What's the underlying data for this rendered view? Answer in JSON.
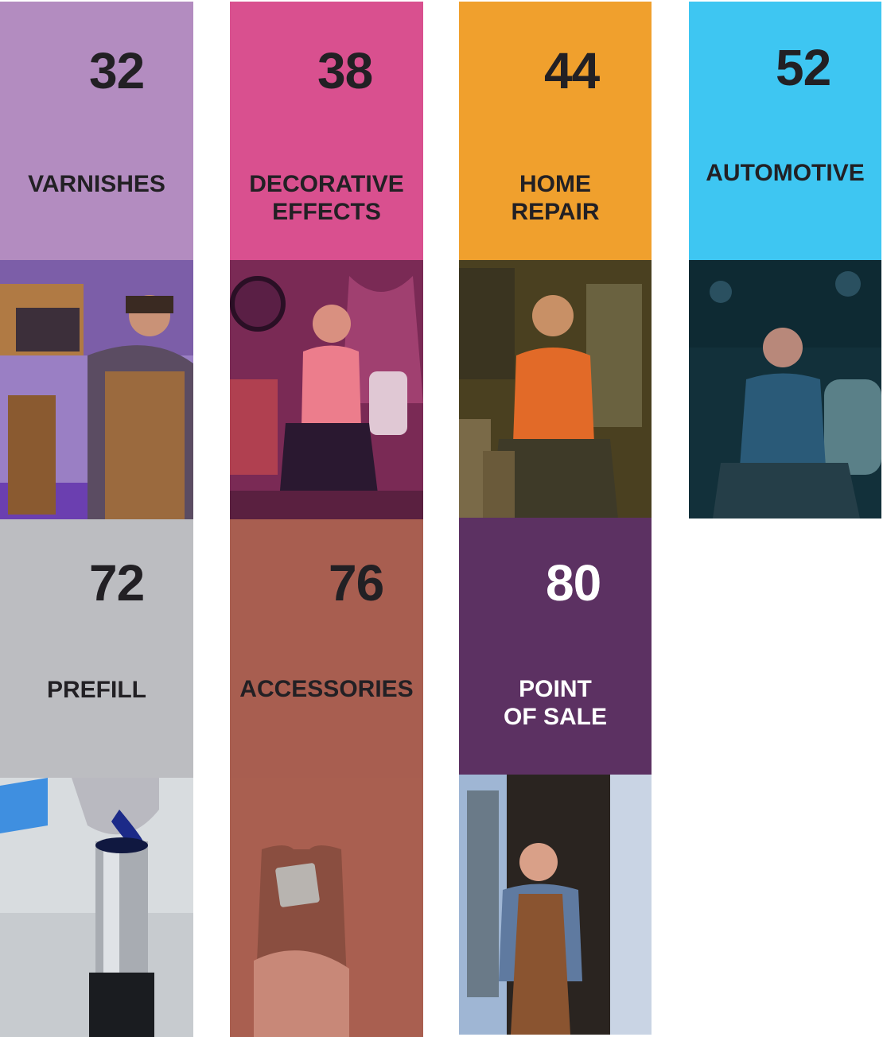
{
  "tiles": [
    {
      "number": "32",
      "label": "VARNISHES",
      "color": "#b38cc0",
      "photo": "craftsman-photo",
      "tint": "#8b6fc8"
    },
    {
      "number": "38",
      "label": "DECORATIVE\nEFFECTS",
      "color": "#d9508f",
      "photo": "woman-sitting-photo",
      "tint": "#b0385f"
    },
    {
      "number": "44",
      "label": "HOME\nREPAIR",
      "color": "#f0a02d",
      "photo": "man-sitting-photo",
      "tint": "#8a6a22"
    },
    {
      "number": "52",
      "label": "AUTOMOTIVE",
      "color": "#3ec6f2",
      "photo": "mechanic-photo",
      "tint": "#1d5d6c"
    },
    {
      "number": "72",
      "label": "PREFILL",
      "color": "#bcbdc1",
      "photo": "paint-pour-photo",
      "tint": "#9aa0a8"
    },
    {
      "number": "76",
      "label": "ACCESSORIES",
      "color": "#a85e50",
      "photo": "apron-photo",
      "tint": "#a86050"
    },
    {
      "number": "80",
      "label": "POINT\nOF SALE",
      "color": "#5c3162",
      "photo": "shopkeeper-photo",
      "tint": "#6b5a4a"
    }
  ]
}
